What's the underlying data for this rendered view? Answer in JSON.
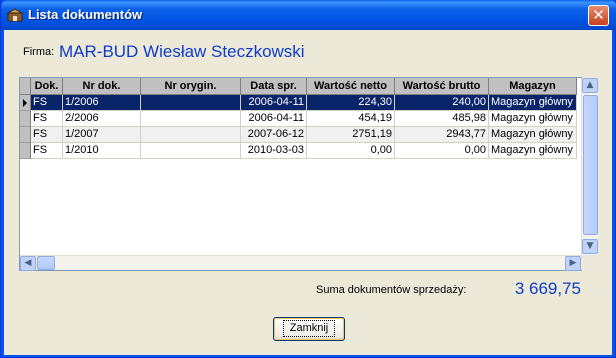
{
  "window": {
    "title": "Lista dokumentów",
    "close_glyph": "✕"
  },
  "firma": {
    "label": "Firma:",
    "value": "MAR-BUD Wiesław Steczkowski"
  },
  "table": {
    "columns": [
      "Dok.",
      "Nr dok.",
      "Nr orygin.",
      "Data spr.",
      "Wartość netto",
      "Wartość brutto",
      "Magazyn"
    ],
    "rows": [
      {
        "dok": "FS",
        "nr": "1/2006",
        "orygin": "",
        "data": "2006-04-11",
        "netto": "224,30",
        "brutto": "240,00",
        "magazyn": "Magazyn główny",
        "selected": true
      },
      {
        "dok": "FS",
        "nr": "2/2006",
        "orygin": "",
        "data": "2006-04-11",
        "netto": "454,19",
        "brutto": "485,98",
        "magazyn": "Magazyn główny"
      },
      {
        "dok": "FS",
        "nr": "1/2007",
        "orygin": "",
        "data": "2007-06-12",
        "netto": "2751,19",
        "brutto": "2943,77",
        "magazyn": "Magazyn główny"
      },
      {
        "dok": "FS",
        "nr": "1/2010",
        "orygin": "",
        "data": "2010-03-03",
        "netto": "0,00",
        "brutto": "0,00",
        "magazyn": "Magazyn główny"
      }
    ]
  },
  "summary": {
    "label": "Suma dokumentów sprzedaży:",
    "value": "3 669,75"
  },
  "buttons": {
    "close_label": "Zamknij"
  },
  "colors": {
    "accent_text": "#0e3cc9",
    "selection": "#0a246a",
    "titlebar": "#0054e3"
  }
}
